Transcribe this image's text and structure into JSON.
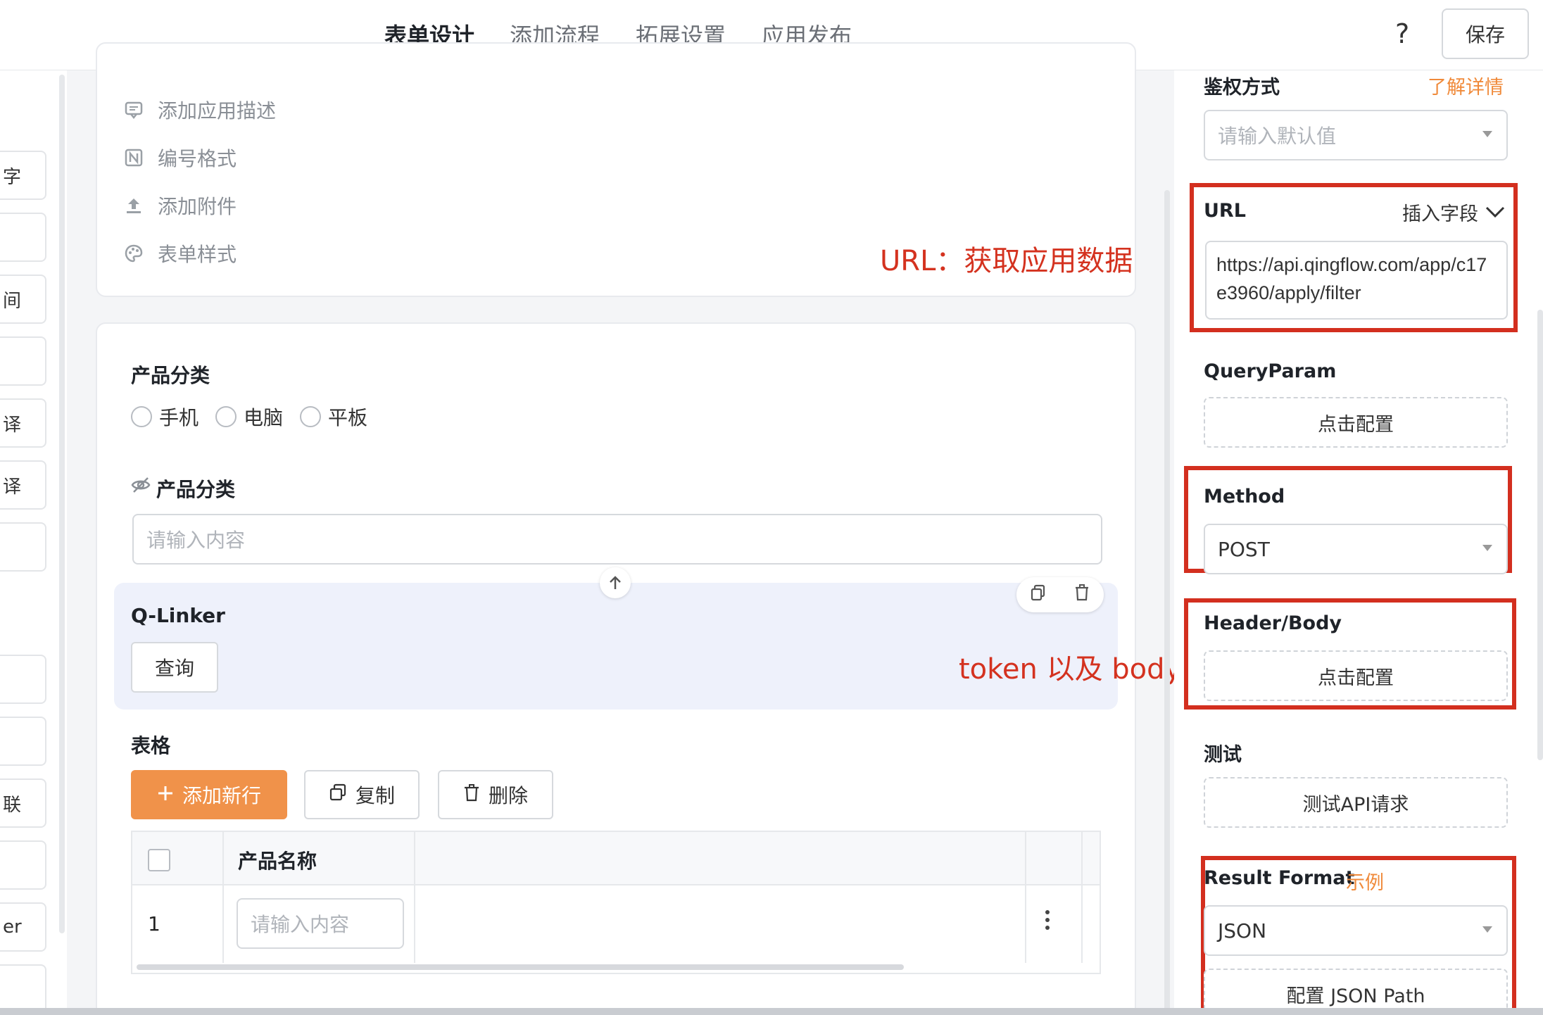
{
  "header": {
    "tabs": [
      "表单设计",
      "添加流程",
      "拓展设置",
      "应用发布"
    ],
    "active_tab": 0,
    "help": "?",
    "save_label": "保存"
  },
  "left_sidebar": {
    "items": [
      "字",
      "",
      "间",
      "",
      "译",
      "译",
      "",
      "",
      "",
      "联",
      "",
      "er",
      ""
    ]
  },
  "form_settings": {
    "items": [
      {
        "icon": "comment-icon",
        "label": "添加应用描述"
      },
      {
        "icon": "number-format-icon",
        "label": "编号格式"
      },
      {
        "icon": "upload-icon",
        "label": "添加附件"
      },
      {
        "icon": "palette-icon",
        "label": "表单样式"
      }
    ]
  },
  "annotations": {
    "url_note": "URL：获取应用数据",
    "token_note": "token 以及 body"
  },
  "form": {
    "field1_label": "产品分类",
    "radio_options": [
      "手机",
      "电脑",
      "平板"
    ],
    "field2_label": "产品分类",
    "field2_placeholder": "请输入内容",
    "qlinker_label": "Q-Linker",
    "query_button": "查询",
    "table_label": "表格",
    "add_row": "添加新行",
    "copy": "复制",
    "delete": "删除",
    "table": {
      "headers": [
        "",
        "产品名称",
        ""
      ],
      "rows": [
        {
          "index": "1",
          "placeholder": "请输入内容"
        }
      ]
    }
  },
  "right_panel": {
    "auth_label": "鉴权方式",
    "auth_link": "了解详情",
    "auth_placeholder": "请输入默认值",
    "url_label": "URL",
    "insert_field": "插入字段",
    "url_value": "https://api.qingflow.com/app/c17e3960/apply/filter",
    "queryparam_label": "QueryParam",
    "click_config": "点击配置",
    "method_label": "Method",
    "method_value": "POST",
    "headerbody_label": "Header/Body",
    "headerbody_button": "点击配置",
    "test_label": "测试",
    "test_button": "测试API请求",
    "result_label": "Result Format",
    "result_link": "示例",
    "result_value": "JSON",
    "jsonpath_button": "配置 JSON Path"
  },
  "colors": {
    "accent": "#f08a3a",
    "annotation_red": "#d32f1f",
    "qlinker_bg": "#eef1fb"
  }
}
